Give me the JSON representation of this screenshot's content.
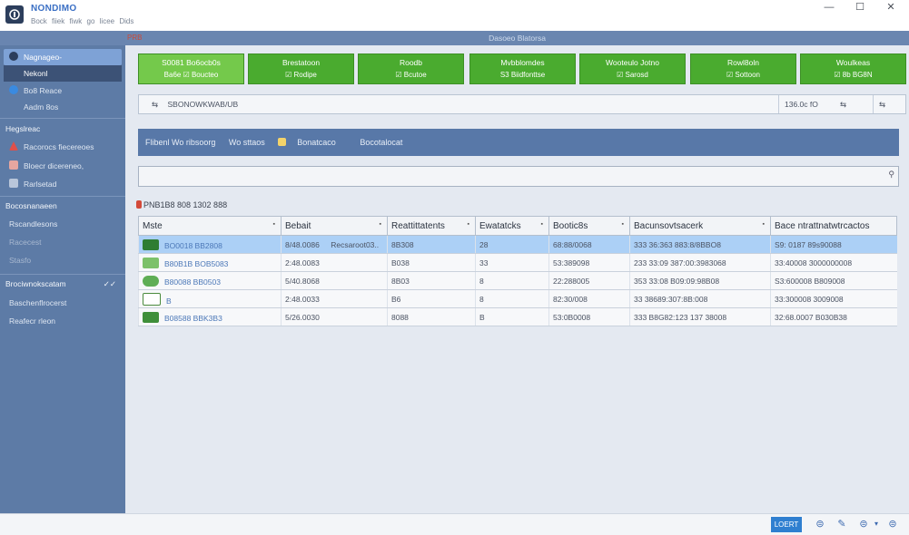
{
  "app": {
    "title": "NONDIMO",
    "menu": [
      "Bock",
      "fiiek fiwk",
      "go",
      "licee",
      "Dids"
    ]
  },
  "window": {
    "minimize": "—",
    "maximize": "☐",
    "close": "✕"
  },
  "sidebar": {
    "items": [
      {
        "label": "Nagnageo-"
      },
      {
        "label": "Nekonl"
      },
      {
        "label": "Bo8 Reace"
      },
      {
        "label": "Aadm 8os"
      }
    ],
    "sections": [
      {
        "title": "Hegslreac",
        "items": [
          "Racorocs fiecereoes",
          "Bloecr dicereneo,",
          "Rarlsetad"
        ]
      },
      {
        "title": "Bocosnanaeen",
        "items": [
          "Rscandlesons",
          "Racecest",
          "Stasfo"
        ]
      },
      {
        "title": "Brociwnokscatam",
        "badge": "✓✓",
        "items": [
          "Baschenflrocerst",
          "Reafecr rleon"
        ]
      }
    ]
  },
  "main": {
    "header_tag": "PRB",
    "header_title": "Dasoeo Blatorsa",
    "actions": [
      {
        "l1": "S0081  Bo6ocb0s",
        "l2": "Ba6e  ☑ Boucteo"
      },
      {
        "l1": "Brestatoon",
        "l2": "☑ Rodipe"
      },
      {
        "l1": "Roodb",
        "l2": "☑ Bcutoe"
      },
      {
        "l1": "Mvbblomdes",
        "l2": "S3 Biidfonttse"
      },
      {
        "l1": "Wooteulo Jotno",
        "l2": "☑ Sarosd"
      },
      {
        "l1": "Rowl8oln",
        "l2": "☑ Sottoon"
      },
      {
        "l1": "Woulkeas",
        "l2": "☑ 8b BG8N"
      }
    ],
    "path": {
      "prefix": "⇆",
      "text": "SBONOWKWAB/UB",
      "right1": "136.0c fO",
      "right2": "⇆",
      "right3": "⇆"
    },
    "filter": {
      "a": "Flibenl Wo ribsoorg",
      "b": "Wo sttaos",
      "c": "Bonatcaco",
      "d": "Bocotalocat"
    },
    "search": {
      "placeholder": "",
      "icon": "⚲"
    },
    "count": {
      "text": "PNB1B8  808  1302  888"
    },
    "table": {
      "headers": [
        "Mste",
        "Bebait",
        "Reattittatents",
        "Ewatatcks",
        "Bootic8s",
        "Bacunsovtsacerk",
        "Bace ntrattnatwtrcactos"
      ],
      "rows": [
        {
          "name": "BO0018 BB2808",
          "c1": "8/48.0086",
          "c1b": "Recsaroot03..",
          "c2": "8B308",
          "c3": "28",
          "c4": "68:88/0068",
          "c5": "333  36:363 883:8/8BBO8",
          "c6": "S9: 0187  89s90088"
        },
        {
          "name": "B80B1B BOB5083",
          "c1": "2:48.0083",
          "c1b": "",
          "c2": "B038",
          "c3": "33",
          "c4": "53:389098",
          "c5": "233  33:09  387:00:3983068",
          "c6": "33:40008  3000000008"
        },
        {
          "name": "B80088 BB0503",
          "c1": "5/40.8068",
          "c1b": "",
          "c2": "8B03",
          "c3": "8",
          "c4": "22:288005",
          "c5": "353  33:08  B09:09:98B08",
          "c6": "S3:600008  B809008"
        },
        {
          "name": "B",
          "c1": "2:48.0033",
          "c1b": "",
          "c2": "B6",
          "c3": "8",
          "c4": "82:30/008",
          "c5": "33  38689:307:8B:008",
          "c6": "33:300008  3009008"
        },
        {
          "name": "B08588 BBK3B3",
          "c1": "5/26.0030",
          "c1b": "",
          "c2": "8088",
          "c3": "B",
          "c4": "53:0B0008",
          "c5": "333  B8G82:123  137 38008",
          "c6": "32:68.0007  B030B38"
        }
      ]
    }
  },
  "statusbar": {
    "button": "LOERT",
    "icons": [
      "⊜",
      "✎",
      "⊜",
      "▾",
      "⊜"
    ]
  }
}
